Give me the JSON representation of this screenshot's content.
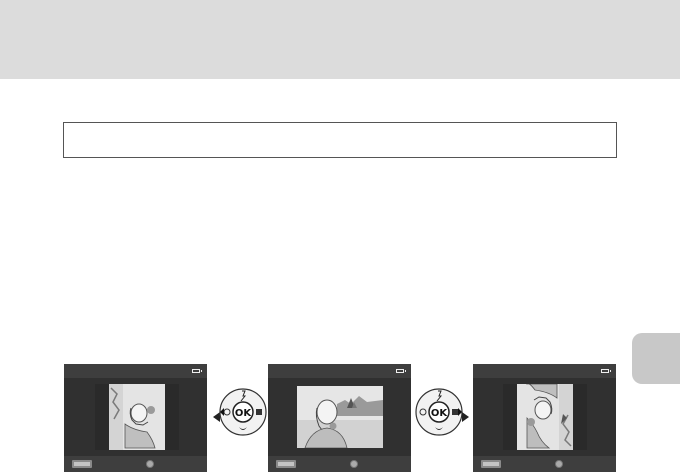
{
  "page": {
    "note_text": "",
    "side_tab_label": ""
  },
  "rotation_example": {
    "screens": [
      {
        "id": "rotated-left",
        "menu_icon": "menu-icon",
        "battery_icon": "battery-icon"
      },
      {
        "id": "original",
        "menu_icon": "menu-icon",
        "battery_icon": "battery-icon"
      },
      {
        "id": "rotated-right",
        "menu_icon": "menu-icon",
        "battery_icon": "battery-icon"
      }
    ],
    "controls": [
      {
        "id": "dial-left",
        "icon": "multi-selector-icon",
        "center_label": "OK",
        "highlight": "left"
      },
      {
        "id": "dial-right",
        "icon": "multi-selector-icon",
        "center_label": "OK",
        "highlight": "right"
      }
    ]
  },
  "colors": {
    "header_band": "#dcdcdc",
    "side_tab": "#c8c8c8",
    "screen_bar": "#3e3e3e"
  }
}
